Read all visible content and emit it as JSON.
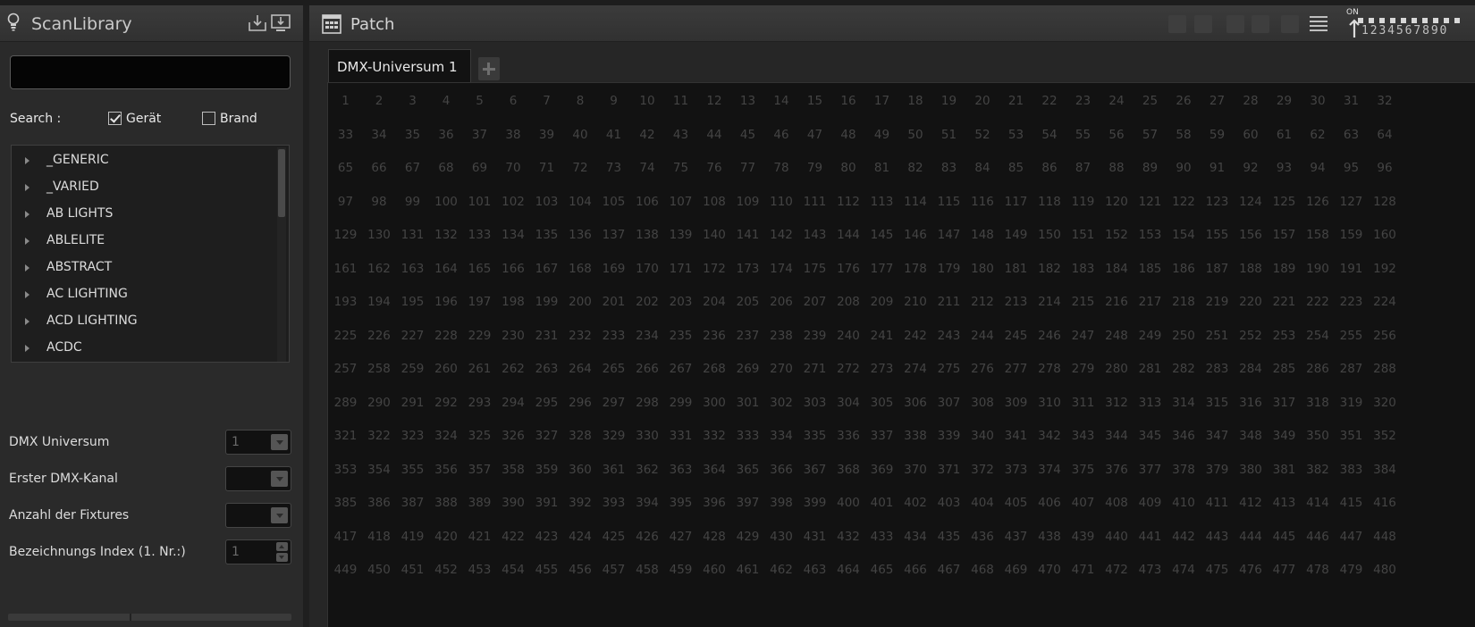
{
  "left_panel": {
    "title": "ScanLibrary",
    "icons": [
      "lightbulb-icon",
      "import-icon",
      "monitor-download-icon"
    ],
    "search": {
      "value": "",
      "label": "Search :",
      "options": [
        {
          "label": "Gerät",
          "checked": true
        },
        {
          "label": "Brand",
          "checked": false
        }
      ]
    },
    "tree_items": [
      "_GENERIC",
      "_VARIED",
      "AB LIGHTS",
      "ABLELITE",
      "ABSTRACT",
      "AC LIGHTING",
      "ACD LIGHTING",
      "ACDC"
    ],
    "fields": [
      {
        "label": "DMX Universum",
        "value": "1",
        "control": "dropdown"
      },
      {
        "label": "Erster DMX-Kanal",
        "value": "",
        "control": "dropdown"
      },
      {
        "label": "Anzahl der Fixtures",
        "value": "",
        "control": "dropdown"
      },
      {
        "label": "Bezeichnungs Index (1. Nr.:)",
        "value": "1",
        "control": "spinner"
      }
    ]
  },
  "right_panel": {
    "title": "Patch",
    "toolbar_icons": [
      "window-icon",
      "copy-icon",
      "settings-icon",
      "edit-icon",
      "delete-icon",
      "list-icon"
    ],
    "universe_selector": {
      "on_label": "ON",
      "digits": "1234567890"
    },
    "tabs": [
      {
        "label": "DMX-Universum 1",
        "active": true
      }
    ],
    "add_tab_icon": "plus-icon",
    "grid": {
      "columns": 32,
      "first_channel": 1,
      "last_visible_channel": 480
    }
  },
  "colors": {
    "background": "#2b2b2b",
    "grid_background": "#121212",
    "channel_text": "#444444",
    "header": "#353535"
  }
}
